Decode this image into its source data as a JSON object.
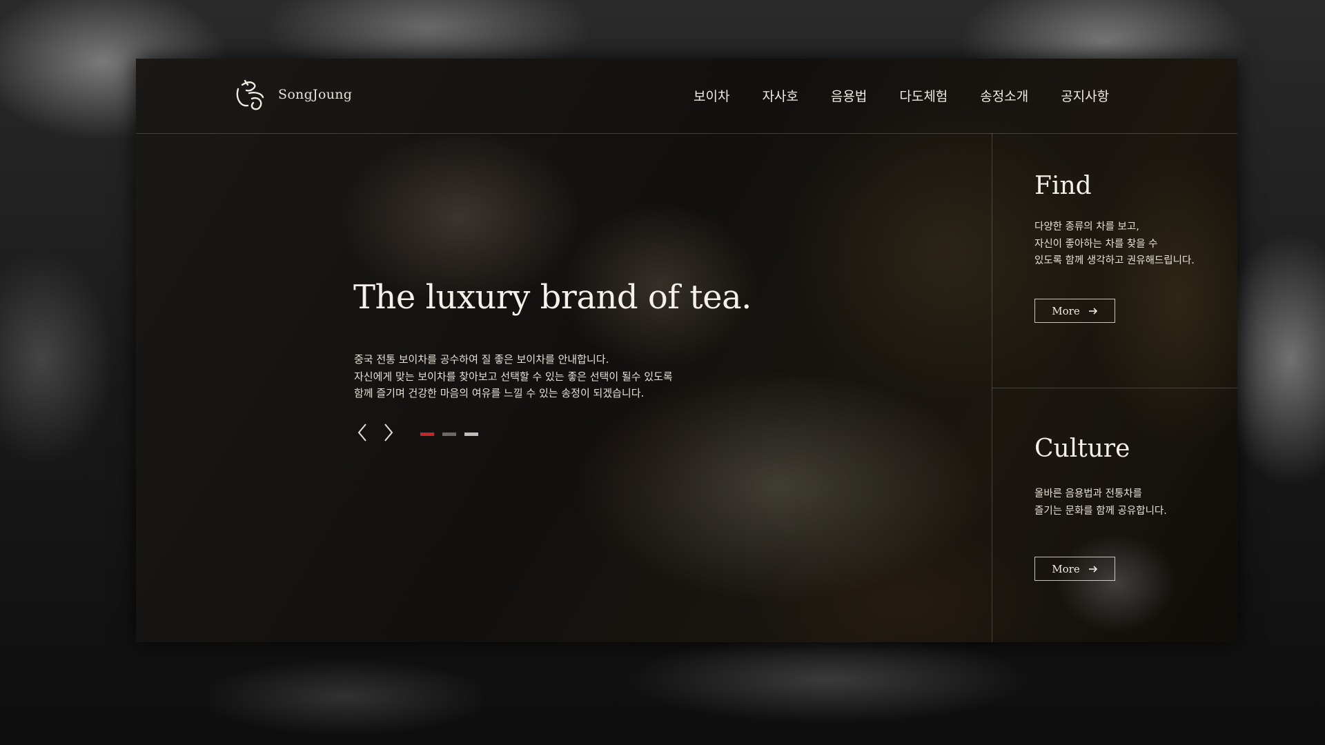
{
  "brand": {
    "name": "SongJoung"
  },
  "nav": {
    "items": [
      {
        "label": "보이차"
      },
      {
        "label": "자사호"
      },
      {
        "label": "음용법"
      },
      {
        "label": "다도체험"
      },
      {
        "label": "송정소개"
      },
      {
        "label": "공지사항"
      }
    ]
  },
  "hero": {
    "title": "The luxury brand of tea.",
    "description": [
      "중국 전통 보이차를 공수하여 질 좋은 보이차를 안내합니다.",
      "자신에게 맞는 보이차를 찾아보고 선택할 수 있는 좋은 선택이 될수 있도록",
      "함께 즐기며 건강한 마음의 여유를 느낄 수 있는 송정이 되겠습니다."
    ],
    "prev_icon": "chevron-left-icon",
    "next_icon": "chevron-right-icon",
    "slides": [
      {
        "color": "#c0282b",
        "active": true
      },
      {
        "color": "#6a6a6a",
        "active": false
      },
      {
        "color": "#bdbdbd",
        "active": false
      }
    ]
  },
  "side": {
    "find": {
      "title": "Find",
      "description": [
        "다양한 종류의 차를 보고,",
        "자신이 좋아하는 차를 찾을 수",
        "있도록 함께 생각하고 권유해드립니다."
      ],
      "button": "More"
    },
    "culture": {
      "title": "Culture",
      "description": [
        "올바른 음용법과 전통차를",
        "즐기는 문화를 함께 공유합니다."
      ],
      "button": "More"
    }
  },
  "colors": {
    "accent": "#c0282b",
    "text": "#f4f1ea"
  }
}
